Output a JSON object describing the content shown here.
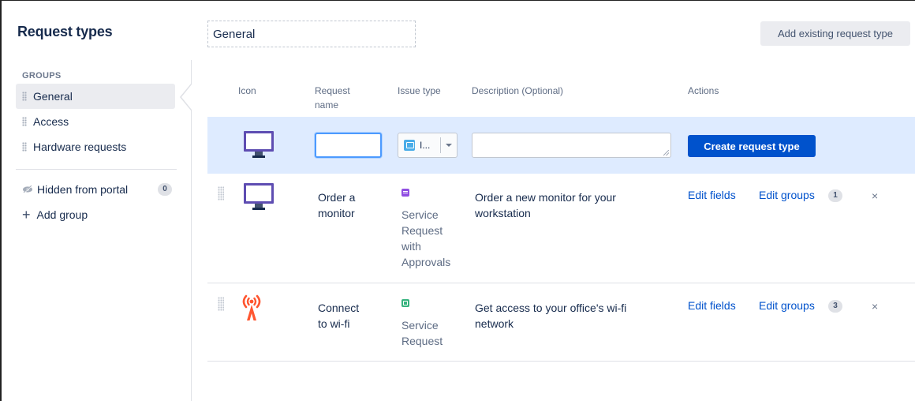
{
  "sidebar": {
    "title": "Request types",
    "groups_label": "GROUPS",
    "groups": [
      {
        "label": "General",
        "active": true
      },
      {
        "label": "Access",
        "active": false
      },
      {
        "label": "Hardware requests",
        "active": false
      }
    ],
    "hidden": {
      "label": "Hidden from portal",
      "count": "0"
    },
    "add_group_label": "Add group"
  },
  "header": {
    "group_name_value": "General",
    "add_existing_label": "Add existing request type"
  },
  "table": {
    "columns": {
      "icon": "Icon",
      "name_line1": "Request",
      "name_line2": "name",
      "issue_type": "Issue type",
      "description": "Description (Optional)",
      "actions": "Actions"
    },
    "create_row": {
      "name_value": "",
      "issue_select_value": "I...",
      "description_value": "",
      "create_label": "Create request type"
    },
    "rows": [
      {
        "icon": "monitor-icon",
        "name_lines": [
          "Order a",
          "monitor"
        ],
        "issue_type_lines": [
          "Service",
          "Request",
          "with",
          "Approvals"
        ],
        "issue_color": "#904ee2",
        "description_lines": [
          "Order a new monitor for your",
          "workstation"
        ],
        "edit_fields": "Edit fields",
        "edit_groups": "Edit groups",
        "groups_count": "1",
        "remove": "×"
      },
      {
        "icon": "wifi-icon",
        "name_lines": [
          "Connect",
          "to wi-fi"
        ],
        "issue_type_lines": [
          "Service",
          "Request"
        ],
        "issue_color": "#36b37e",
        "description_lines": [
          "Get access to your office's wi-fi",
          "network"
        ],
        "edit_fields": "Edit fields",
        "edit_groups": "Edit groups",
        "groups_count": "3",
        "remove": "×"
      }
    ]
  },
  "colors": {
    "accent": "#0052cc",
    "create_row_bg": "#deebff",
    "monitor_icon": "#5e4db2",
    "wifi_icon": "#ff5630"
  }
}
